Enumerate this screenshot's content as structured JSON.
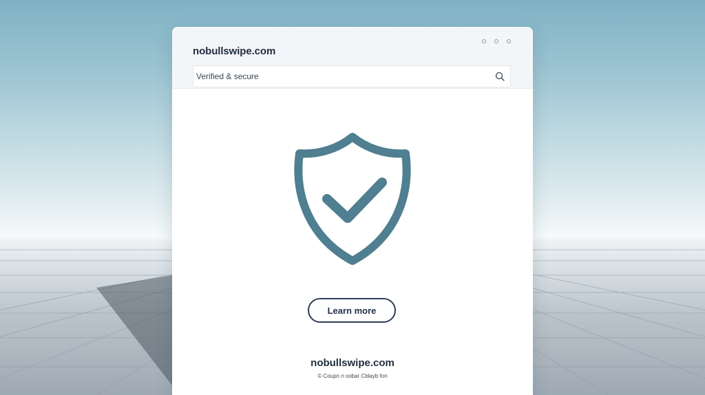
{
  "browser": {
    "site_title": "nobullswipe.com",
    "address_text": "Verified & secure",
    "window_controls": [
      "minimize-control",
      "restore-control",
      "close-control"
    ]
  },
  "main": {
    "hero_icon": "shield-check-icon",
    "cta_label": "Learn more"
  },
  "footer": {
    "brand": "nobullswipe.com",
    "copyright": "© Coupn 𝑛 oobar Cblayb fon"
  },
  "colors": {
    "shield": "#4f7f90",
    "button_border": "#2c3e55",
    "text_dark": "#1f2d3d"
  }
}
